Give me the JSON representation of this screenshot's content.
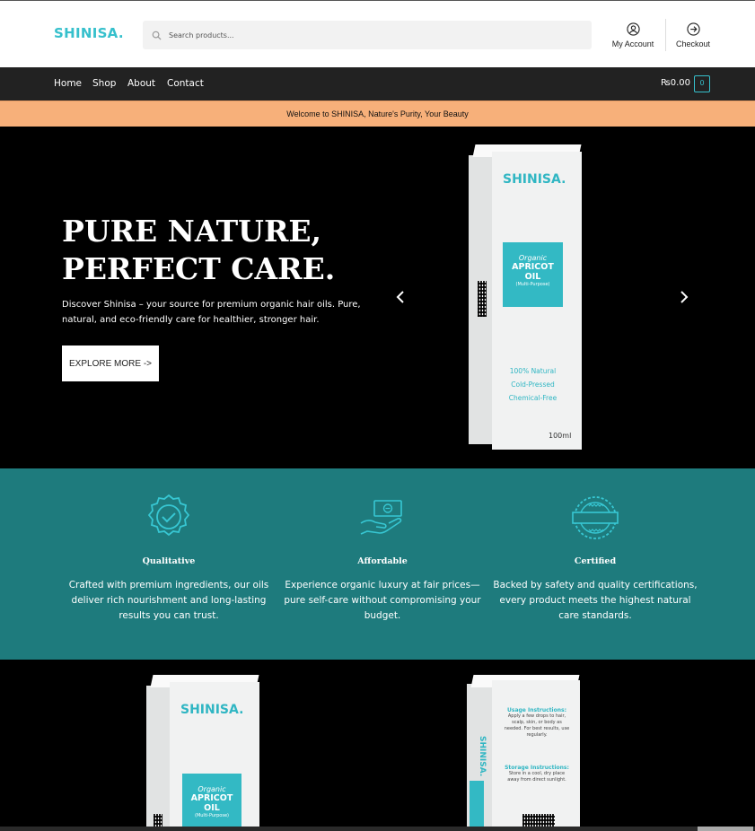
{
  "header": {
    "logo": "SHINISA.",
    "search_placeholder": "Search products...",
    "my_account": "My Account",
    "checkout": "Checkout"
  },
  "nav": {
    "items": [
      "Home",
      "Shop",
      "About",
      "Contact"
    ],
    "cart_amount": "₨0.00",
    "cart_count": "0"
  },
  "notice": "Welcome to SHINISA, Nature's Purity, Your Beauty",
  "hero": {
    "title_line1": "PURE NATURE,",
    "title_line2": "PERFECT CARE.",
    "description": "Discover Shinisa – your source for premium organic hair oils. Pure, natural, and eco-friendly care for healthier, stronger hair.",
    "button": "EXPLORE MORE ->",
    "product": {
      "brand": "SHINISA.",
      "label_top": "Organic",
      "label_main": "APRICOT OIL",
      "label_sub": "(Multi-Purpose)",
      "claim1": "100% Natural",
      "claim2": "Cold-Pressed",
      "claim3": "Chemical-Free",
      "volume": "100ml"
    }
  },
  "features": [
    {
      "icon": "quality-badge-icon",
      "title": "Qualitative",
      "desc": "Crafted with premium ingredients, our oils deliver rich nourishment and long-lasting results you can trust."
    },
    {
      "icon": "money-hand-icon",
      "title": "Affordable",
      "desc": "Experience organic luxury at fair prices—pure self-care without compromising your budget."
    },
    {
      "icon": "certified-stamp-icon",
      "title": "Certified",
      "desc": "Backed by safety and quality certifications, every product meets the highest natural care standards."
    }
  ],
  "bottom": {
    "box1": {
      "brand": "SHINISA.",
      "label_top": "Organic",
      "label_main": "APRICOT OIL",
      "label_sub": "(Multi-Purpose)"
    },
    "box2": {
      "side_brand": "SHINISA.",
      "usage_title": "Usage Instructions:",
      "usage_text": "Apply a few drops to hair, scalp, skin, or body as needed. For best results, use regularly.",
      "storage_title": "Storage Instructions:",
      "storage_text": "Store in a cool, dry place away from direct sunlight."
    }
  },
  "colors": {
    "brand": "#36c0cc",
    "teal_band": "#1e7b7d",
    "notice": "#f7b07a",
    "nav": "#222222"
  }
}
